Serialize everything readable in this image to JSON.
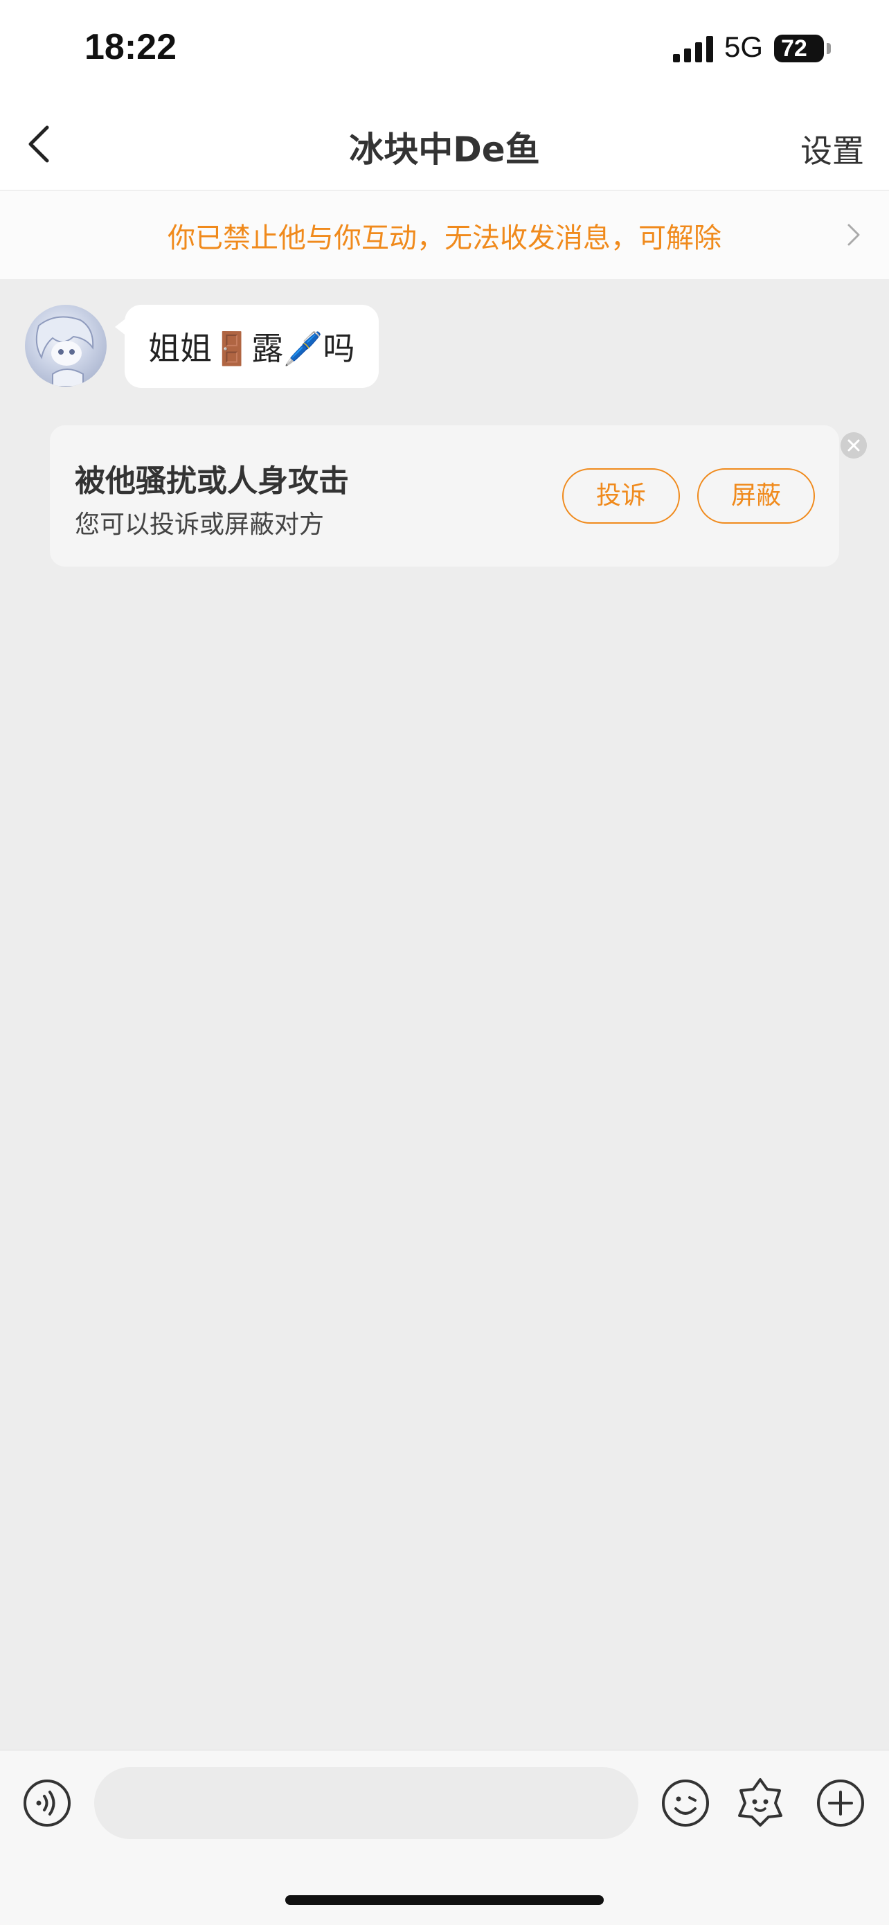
{
  "status_bar": {
    "time": "18:22",
    "network": "5G",
    "battery": "72"
  },
  "header": {
    "title": "冰块中De鱼",
    "settings_label": "设置"
  },
  "banner": {
    "text": "你已禁止他与你互动，无法收发消息，可解除"
  },
  "message": {
    "text": "姐姐🚪露🖊️吗"
  },
  "harassment_card": {
    "title": "被他骚扰或人身攻击",
    "subtitle": "您可以投诉或屏蔽对方",
    "report_label": "投诉",
    "block_label": "屏蔽"
  },
  "input_bar": {
    "placeholder": ""
  },
  "colors": {
    "accent": "#f08a1c",
    "background": "#ededed"
  },
  "icons": [
    "back-icon",
    "chevron-right-icon",
    "voice-icon",
    "emoji-icon",
    "sticker-icon",
    "plus-icon",
    "close-icon"
  ]
}
